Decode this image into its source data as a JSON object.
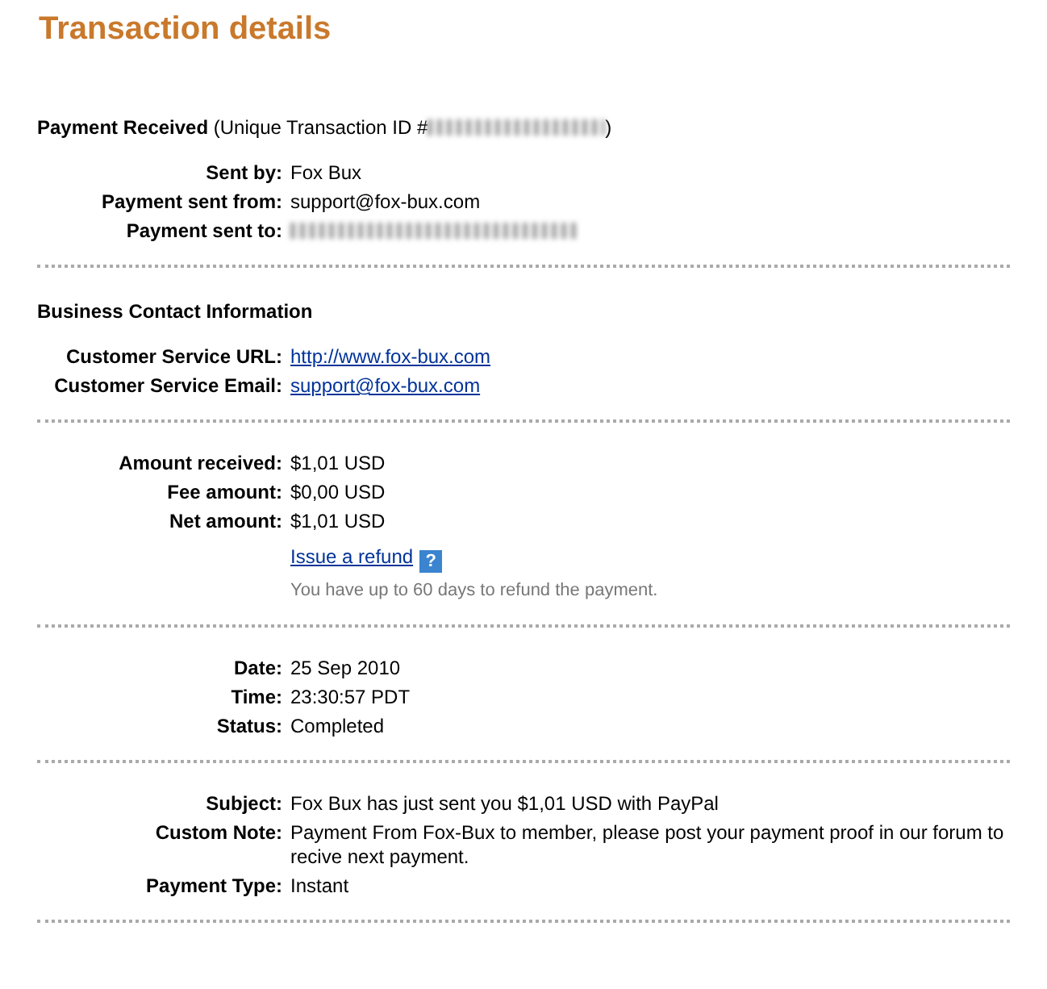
{
  "title": "Transaction details",
  "sections": [
    {
      "heading": {
        "bold": "Payment Received",
        "rest": "(Unique Transaction ID #",
        "end": ")",
        "redacted": true
      },
      "rows": [
        {
          "label": "Sent by:",
          "value": "Fox Bux",
          "kind": "text"
        },
        {
          "label": "Payment sent from:",
          "value": "support@fox-bux.com",
          "kind": "text"
        },
        {
          "label": "Payment sent to:",
          "kind": "redacted"
        }
      ]
    },
    {
      "heading": {
        "bold": "Business Contact Information"
      },
      "rows": [
        {
          "label": "Customer Service URL:",
          "value": "http://www.fox-bux.com",
          "kind": "link"
        },
        {
          "label": "Customer Service Email:",
          "value": "support@fox-bux.com",
          "kind": "link"
        }
      ]
    },
    {
      "rows": [
        {
          "label": "Amount received:",
          "value": "$1,01 USD",
          "kind": "text"
        },
        {
          "label": "Fee amount:",
          "value": "$0,00 USD",
          "kind": "text"
        },
        {
          "label": "Net amount:",
          "value": "$1,01 USD",
          "kind": "text"
        },
        {
          "value": "Issue a refund",
          "kind": "refund",
          "icon_text": "?"
        },
        {
          "value": "You have up to 60 days to refund the payment.",
          "kind": "hint"
        }
      ]
    },
    {
      "rows": [
        {
          "label": "Date:",
          "value": "25 Sep 2010",
          "kind": "text"
        },
        {
          "label": "Time:",
          "value": "23:30:57 PDT",
          "kind": "text"
        },
        {
          "label": "Status:",
          "value": "Completed",
          "kind": "text"
        }
      ]
    },
    {
      "rows": [
        {
          "label": "Subject:",
          "value": "Fox Bux has just sent you $1,01 USD with PayPal",
          "kind": "text"
        },
        {
          "label": "Custom Note:",
          "value": "Payment From Fox-Bux to member, please post your payment proof in our forum to recive next payment.",
          "kind": "text"
        },
        {
          "label": "Payment Type:",
          "value": "Instant",
          "kind": "text"
        }
      ]
    }
  ]
}
